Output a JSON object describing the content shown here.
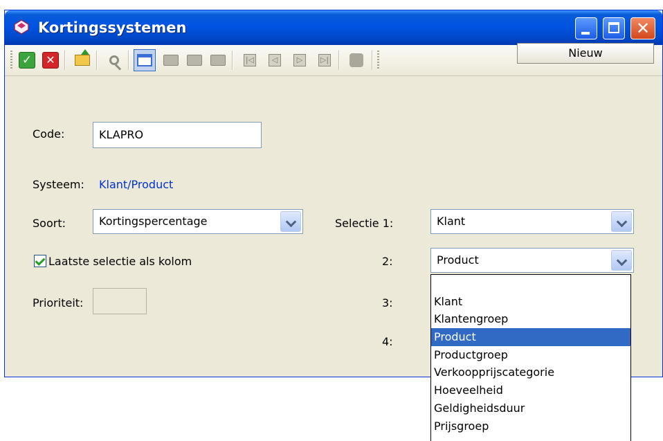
{
  "window": {
    "title": "Kortingssystemen",
    "close_glyph": "✕"
  },
  "toolbar": {
    "icons": [
      "check-icon",
      "cross-icon",
      "export-icon",
      "search-icon",
      "window-icon",
      "copy-icon",
      "folder-open-icon",
      "folder-icon",
      "first-record-icon",
      "previous-record-icon",
      "next-record-icon",
      "last-record-icon",
      "puzzle-icon"
    ],
    "ok_glyph": "✓",
    "cancel_glyph": "✕",
    "nav_first": "|◁",
    "nav_prev": "◁",
    "nav_next": "▷",
    "nav_last": "▷|",
    "new_label": "Nieuw"
  },
  "form": {
    "code_label": "Code:",
    "code_value": "KLAPRO",
    "system_label": "Systeem:",
    "system_value": "Klant/Product",
    "sort_label": "Soort:",
    "sort_value": "Kortingspercentage",
    "last_selection_label": "Laatste selectie als kolom",
    "last_selection_checked": true,
    "priority_label": "Prioriteit:",
    "priority_value": ""
  },
  "selection": {
    "label_1": "Selectie 1:",
    "label_2": "2:",
    "label_3": "3:",
    "label_4": "4:",
    "value_1": "Klant",
    "value_2": "Product"
  },
  "dropdown": {
    "options": [
      "",
      "Klant",
      "Klantengroep",
      "Product",
      "Productgroep",
      "Verkoopprijscategorie",
      "Hoeveelheid",
      "Geldigheidsduur",
      "Prijsgroep"
    ],
    "selected": "Product"
  },
  "colors": {
    "title_bar": "#0054e3",
    "selection_highlight": "#316ac5",
    "system_value": "#0033cc"
  }
}
